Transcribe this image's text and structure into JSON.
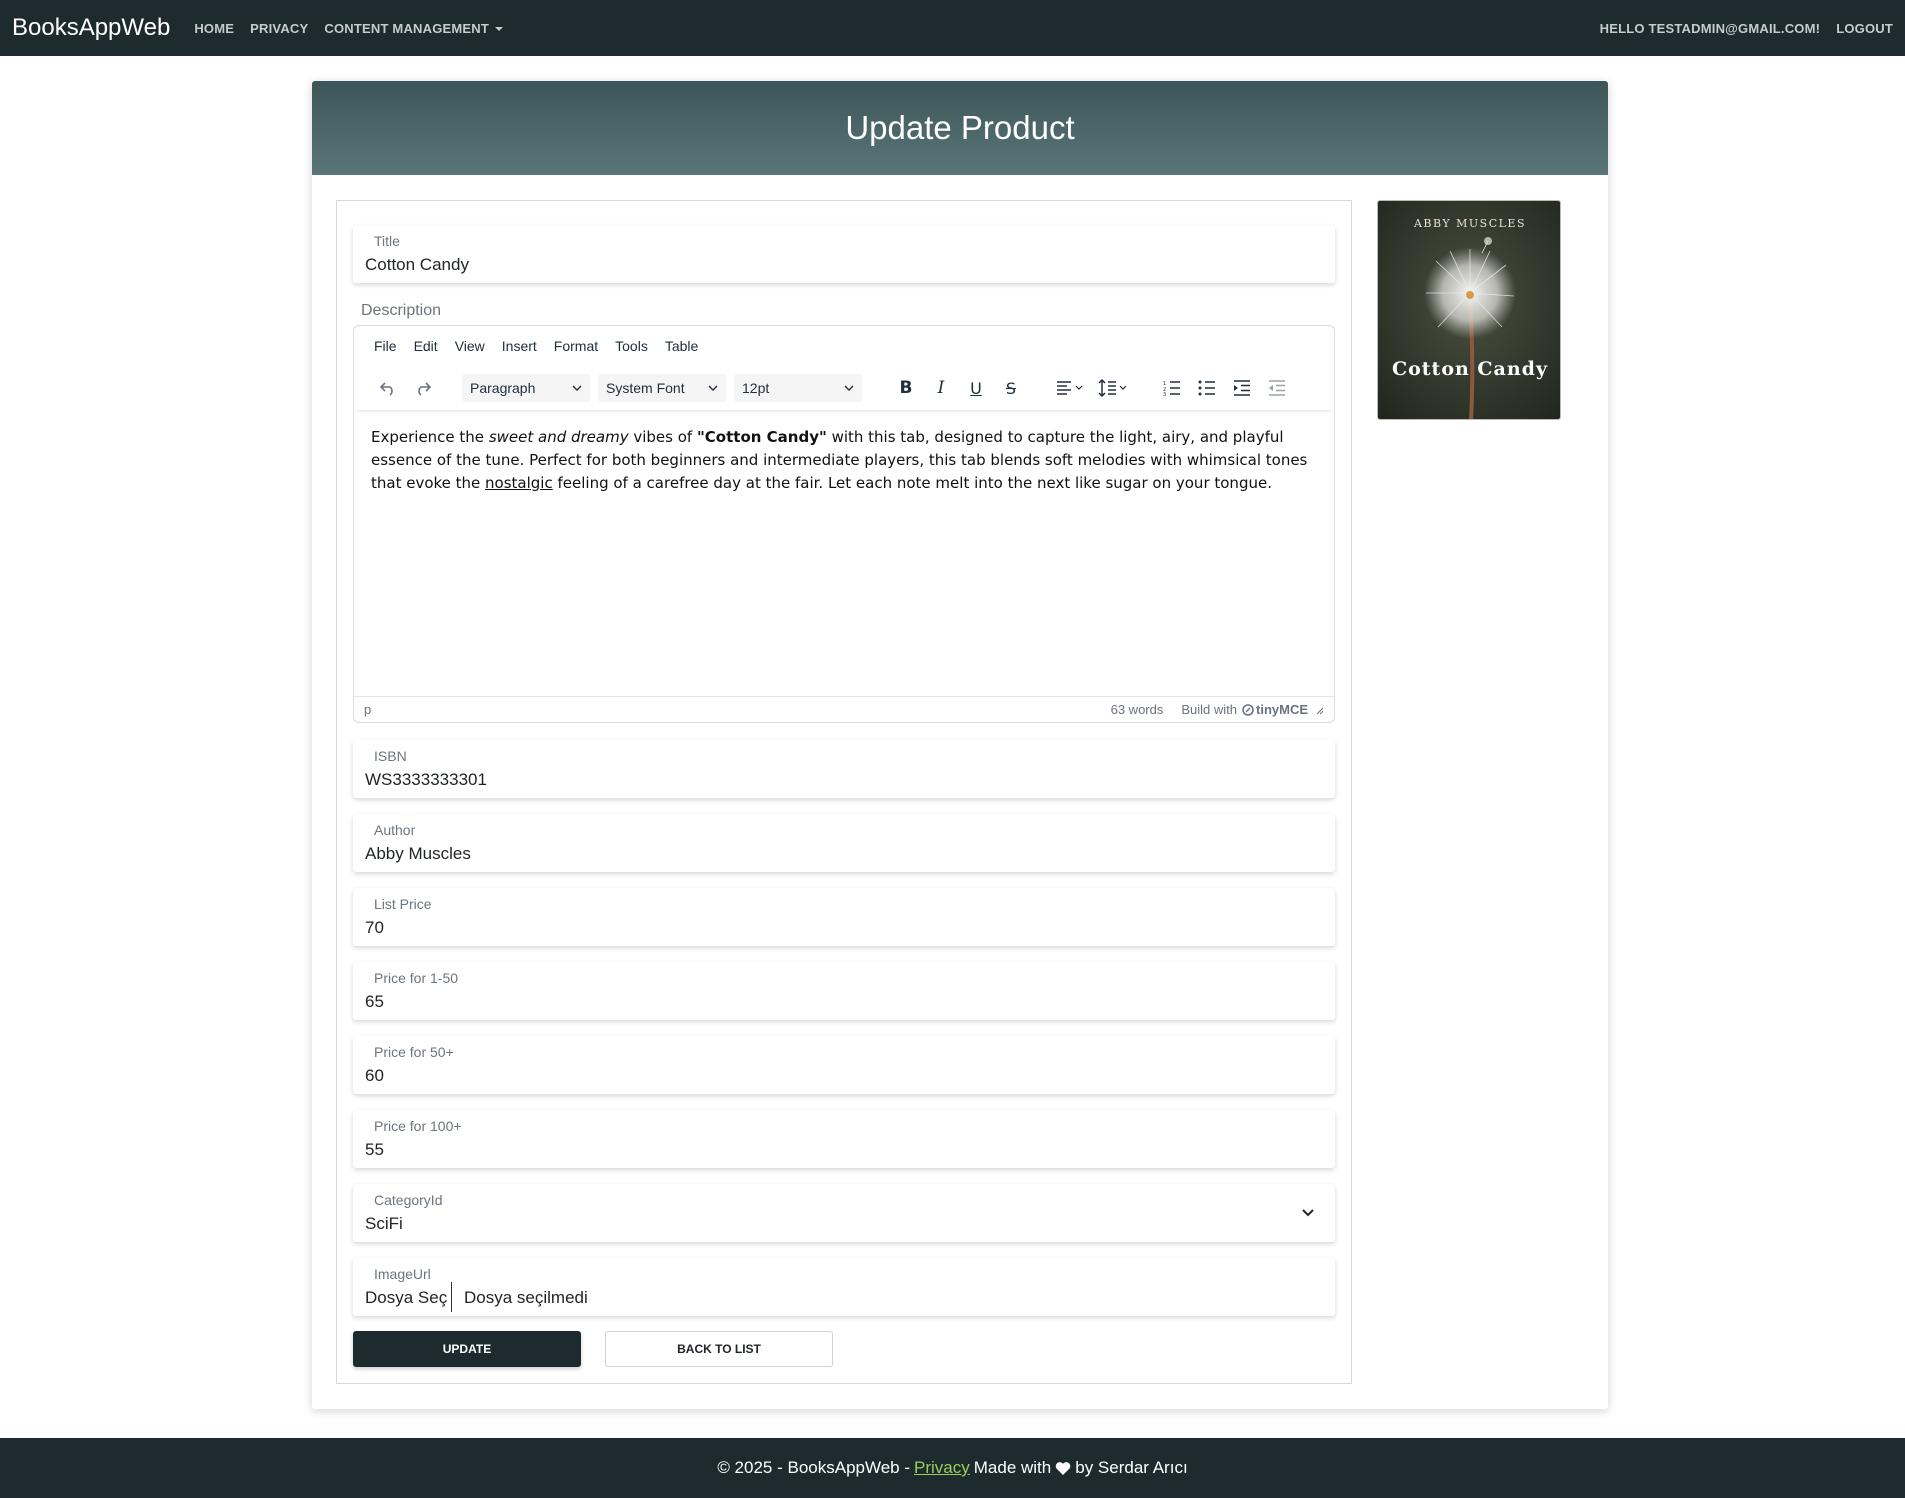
{
  "navbar": {
    "brand": "BooksAppWeb",
    "links": [
      "HOME",
      "PRIVACY",
      "CONTENT MANAGEMENT"
    ],
    "greeting": "HELLO TESTADMIN@GMAIL.COM!",
    "logout": "LOGOUT"
  },
  "page": {
    "title": "Update Product"
  },
  "form": {
    "title_label": "Title",
    "title_value": "Cotton Candy",
    "description_label": "Description",
    "isbn_label": "ISBN",
    "isbn_value": "WS3333333301",
    "author_label": "Author",
    "author_value": "Abby Muscles",
    "list_price_label": "List Price",
    "list_price_value": "70",
    "price_1_50_label": "Price for 1-50",
    "price_1_50_value": "65",
    "price_50_label": "Price for 50+",
    "price_50_value": "60",
    "price_100_label": "Price for 100+",
    "price_100_value": "55",
    "category_label": "CategoryId",
    "category_value": "SciFi",
    "image_label": "ImageUrl",
    "file_button": "Dosya Seç",
    "file_status": "Dosya seçilmedi",
    "update_button": "UPDATE",
    "back_button": "BACK TO LIST"
  },
  "editor": {
    "menu": [
      "File",
      "Edit",
      "View",
      "Insert",
      "Format",
      "Tools",
      "Table"
    ],
    "block_format": "Paragraph",
    "font_family": "System Font",
    "font_size": "12pt",
    "content": {
      "part1": "Experience the ",
      "italic": "sweet and dreamy",
      "part2": " vibes of ",
      "bold": "\"Cotton Candy\"",
      "part3": " with this tab, designed to capture the light, airy, and playful essence of the tune. Perfect for both beginners and intermediate players, this tab blends soft melodies with whimsical tones that evoke the ",
      "underline": "nostalgic",
      "part4": " feeling of a carefree day at the fair. Let each note melt into the next like sugar on your tongue."
    },
    "status_path": "p",
    "word_count": "63 words",
    "branding": "Build with",
    "branding_logo": "tinyMCE"
  },
  "cover": {
    "author": "ABBY MUSCLES",
    "title": "Cotton Candy"
  },
  "footer": {
    "prefix": "© 2025 - BooksAppWeb -",
    "privacy": "Privacy",
    "made_with": "Made with",
    "by": "by Serdar Arıcı"
  },
  "colors": {
    "navbar_bg": "#1d2b2f",
    "header_gradient_top": "#3b5558",
    "header_gradient_bottom": "#5b7679",
    "footer_link": "#9acd5b"
  }
}
